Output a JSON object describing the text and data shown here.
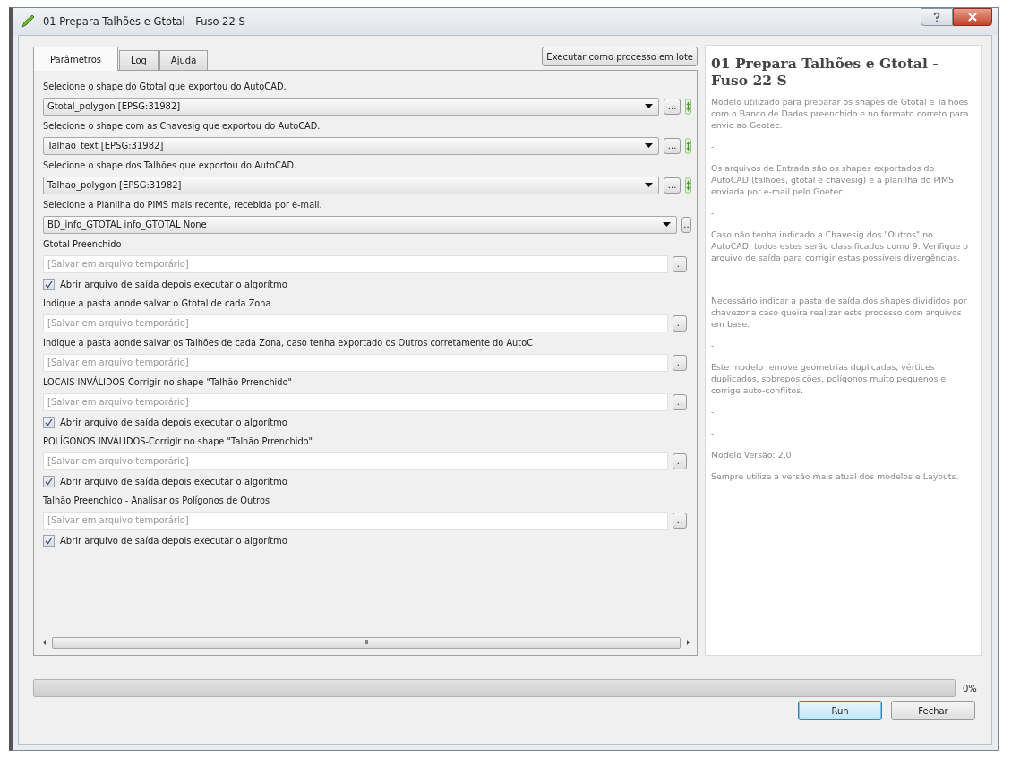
{
  "window": {
    "title": "01 Prepara Talhões e Gtotal - Fuso 22 S"
  },
  "tabs": [
    {
      "label": "Parâmetros",
      "selected": true
    },
    {
      "label": "Log",
      "selected": false
    },
    {
      "label": "Ajuda",
      "selected": false
    }
  ],
  "batch_button": "Executar como processo em lote",
  "parameters": [
    {
      "kind": "label",
      "text": "Selecione o shape do Gtotal que exportou do AutoCAD."
    },
    {
      "kind": "layer_combo",
      "value": "Gtotal_polygon [EPSG:31982]",
      "button": "..."
    },
    {
      "kind": "label",
      "text": "Selecione o shape com as Chavesig que exportou do AutoCAD."
    },
    {
      "kind": "layer_combo",
      "value": "Talhao_text [EPSG:31982]",
      "button": "..."
    },
    {
      "kind": "label",
      "text": "Selecione o shape dos Talhões que exportou do AutoCAD."
    },
    {
      "kind": "layer_combo",
      "value": "Talhao_polygon [EPSG:31982]",
      "button": "..."
    },
    {
      "kind": "label",
      "text": "Selecione a Planilha do PIMS mais recente, recebida por e-mail."
    },
    {
      "kind": "combo",
      "value": "BD_info_GTOTAL info_GTOTAL None",
      "button": ".."
    },
    {
      "kind": "label",
      "text": "Gtotal Preenchido"
    },
    {
      "kind": "output",
      "placeholder": "[Salvar em arquivo temporário]",
      "button": ".."
    },
    {
      "kind": "checkbox",
      "label": "Abrir arquivo de saída depois executar o algorítmo",
      "checked": true
    },
    {
      "kind": "label",
      "text": "Indique a pasta anode salvar o Gtotal de cada Zona"
    },
    {
      "kind": "output",
      "placeholder": "[Salvar em arquivo temporário]",
      "button": ".."
    },
    {
      "kind": "label",
      "text": "Indique a pasta aonde salvar os Talhões de cada Zona, caso tenha exportado os Outros corretamente do AutoC"
    },
    {
      "kind": "output",
      "placeholder": "[Salvar em arquivo temporário]",
      "button": ".."
    },
    {
      "kind": "label",
      "text": "LOCAIS INVÁLIDOS-Corrigir no shape \"Talhão Prrenchido\""
    },
    {
      "kind": "output",
      "placeholder": "[Salvar em arquivo temporário]",
      "button": ".."
    },
    {
      "kind": "checkbox",
      "label": "Abrir arquivo de saída depois executar o algorítmo",
      "checked": true
    },
    {
      "kind": "label",
      "text": "POLÍGONOS INVÁLIDOS-Corrigir no shape \"Talhão Prrenchido\""
    },
    {
      "kind": "output",
      "placeholder": "[Salvar em arquivo temporário]",
      "button": ".."
    },
    {
      "kind": "checkbox",
      "label": "Abrir arquivo de saída depois executar o algorítmo",
      "checked": true
    },
    {
      "kind": "label",
      "text": "Talhão Preenchido - Analisar os Polígonos de Outros"
    },
    {
      "kind": "output",
      "placeholder": "[Salvar em arquivo temporário]",
      "button": ".."
    },
    {
      "kind": "checkbox",
      "label": "Abrir arquivo de saída depois executar o algorítmo",
      "checked": true
    }
  ],
  "scrollbar_grip": "III",
  "help": {
    "title": "01 Prepara Talhões e Gtotal - Fuso 22 S",
    "paragraphs": [
      "Modelo utilizado para preparar os shapes de Gtotal e Talhões com o Banco de Dados preenchido e no formato correto para envio ao Geotec.",
      "-",
      "Os arquivos de Entrada são os shapes exportados do AutoCAD (talhões, gtotal e chavesig) e a planilha do PIMS enviada por e-mail pelo Goetec.",
      "-",
      "Caso não tenha indicado a Chavesig dos \"Outros\" no AutoCAD, todos estes serão classificados como 9. Verifique o arquivo de saída para corrigir estas possíveis divergências.",
      "-",
      "Necessário indicar a pasta de saída dos shapes divididos por chavezona caso queira realizar este processo com arquivos em base.",
      "-",
      "Este modelo remove geometrias duplicadas, vértices duplicados, sobreposições, polígonos muito pequenos e corrige auto-conflitos.",
      "-",
      "-",
      "Modelo Versão: 2.0",
      "Sempre utilize a versão mais atual dos modelos e Layouts."
    ]
  },
  "progress": {
    "level": 0,
    "reading": "0%"
  },
  "buttons": [
    {
      "label": "Run",
      "default": true
    },
    {
      "label": "Fechar",
      "default": false
    }
  ]
}
